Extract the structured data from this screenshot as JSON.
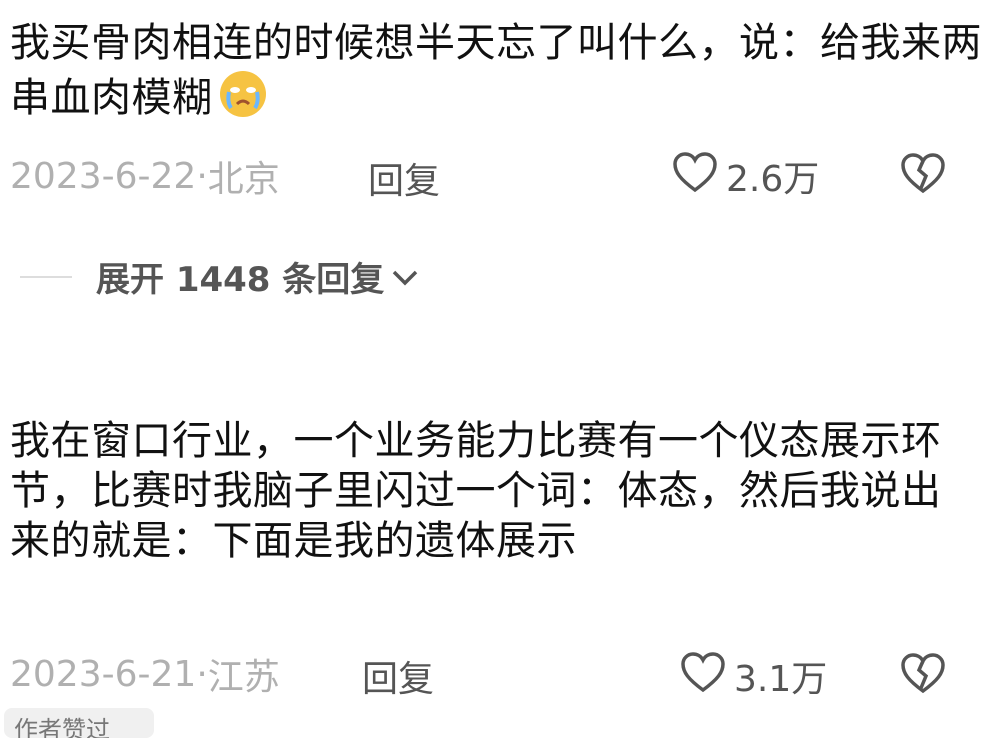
{
  "comments": [
    {
      "text": "我买骨肉相连的时候想半天忘了叫什么，说：给我来两串血肉模糊",
      "emoji": "crying-face-emoji",
      "date": "2023-6-22",
      "location": "北京",
      "reply_label": "回复",
      "likes": "2.6万"
    },
    {
      "text": "我在窗口行业，一个业务能力比赛有一个仪态展示环节，比赛时我脑子里闪过一个词：体态，然后我说出来的就是：下面是我的遗体展示",
      "date": "2023-6-21",
      "location": "江苏",
      "reply_label": "回复",
      "likes": "3.1万"
    }
  ],
  "expand_replies": {
    "label": "展开 1448 条回复"
  },
  "author_badge": {
    "label": "作者赞过"
  },
  "colors": {
    "text": "#111111",
    "meta": "#b0b0b0",
    "action": "#555555"
  }
}
